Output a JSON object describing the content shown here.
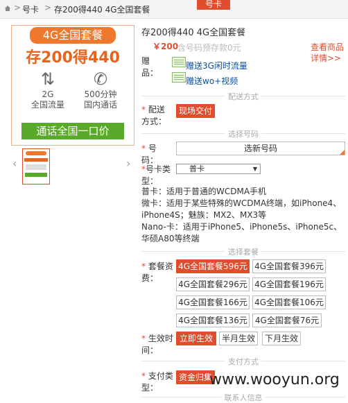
{
  "breadcrumb": {
    "item1": "号卡",
    "sep": ">",
    "item2": "存200得440 4G全国套餐"
  },
  "top_tab": "号卡",
  "product_image": {
    "pill": "4G全国套餐",
    "headline": "存200得440",
    "stat1_line1": "2G",
    "stat1_line2": "全国流量",
    "stat2_line1": "500分钟",
    "stat2_line2": "国内通话",
    "banner": "通话全国一口价"
  },
  "product": {
    "title": "存200得440 4G全国套餐",
    "price": "￥200",
    "deposit": "含号码预存款0元",
    "check_details": "查看商品详情>>",
    "gift_label": "赠品：",
    "gifts": [
      "赠送3G闲时流量",
      "赠送wo+视频"
    ]
  },
  "sections": {
    "delivery": "配送方式",
    "number": "选择号码",
    "package": "选择套餐",
    "payment": "支付方式",
    "contact": "联系人信息"
  },
  "delivery": {
    "label": "配送方式：",
    "option": "现场交付"
  },
  "number": {
    "label": "号码：",
    "input": "选新号码"
  },
  "card_type": {
    "label": "号卡类型：",
    "selected": "普卡"
  },
  "card_notes": [
    "普卡：适用于普通的WCDMA手机",
    "微卡：适用于某些特殊的WCDMA终端，如iPhone4、iPhone4S；魅族：MX2、MX3等",
    "Nano-卡：适用于iPhone5、iPhone5s、iPhone5c、华硕A80等终端"
  ],
  "package": {
    "label": "套餐资费：",
    "options": [
      "4G全国套餐596元",
      "4G全国套餐396元",
      "4G全国套餐296元",
      "4G全国套餐196元",
      "4G全国套餐166元",
      "4G全国套餐106元",
      "4G全国套餐136元",
      "4G全国套餐76元"
    ]
  },
  "effective": {
    "label": "生效时间：",
    "options": [
      "立即生效",
      "半月生效",
      "下月生效"
    ]
  },
  "payment": {
    "label": "支付类型：",
    "option": "资金归集"
  },
  "watermark": "www.wooyun.org",
  "colors": {
    "accent": "#e14c2d",
    "orange": "#f0782c",
    "green": "#5aaa2a",
    "link": "#0b4fa0"
  }
}
